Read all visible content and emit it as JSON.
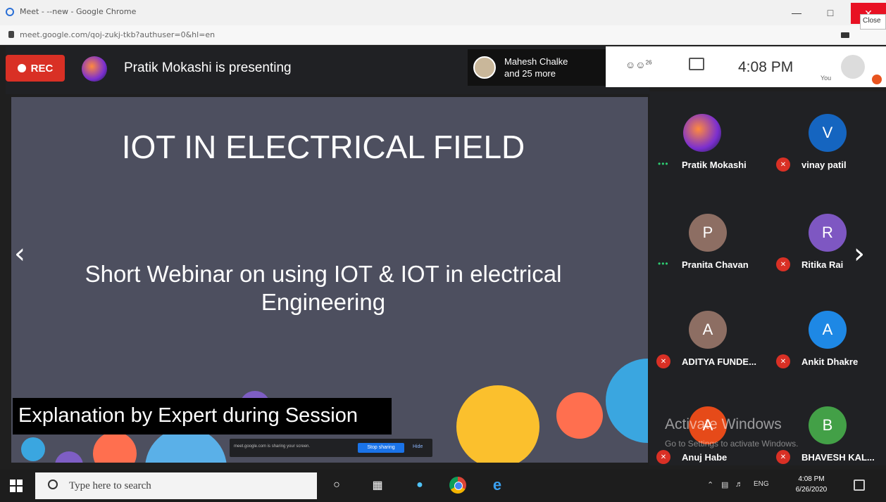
{
  "browser": {
    "window_title": "Meet - --new - Google Chrome",
    "url": "meet.google.com/qoj-zukj-tkb?authuser=0&hl=en",
    "close_tooltip": "Close"
  },
  "meet": {
    "rec_label": "REC",
    "presenting_text": "Pratik Mokashi is presenting",
    "attendees_line1": "Mahesh Chalke",
    "attendees_line2": "and 25 more",
    "people_count": "26",
    "time": "4:08 PM",
    "you_label": "You"
  },
  "slide": {
    "title": "IOT IN ELECTRICAL FIELD",
    "subtitle_line1": "Short Webinar on using IOT & IOT in electrical",
    "subtitle_line2": "Engineering",
    "caption": "Explanation by Expert during Session"
  },
  "share_bar": {
    "text": "meet.google.com is sharing your screen.",
    "stop_label": "Stop sharing",
    "hide_label": "Hide"
  },
  "participants": [
    {
      "name": "Pratik Mokashi",
      "initial": "",
      "color": "#3a2a66",
      "status": "speaking"
    },
    {
      "name": "vinay patil",
      "initial": "V",
      "color": "#1565c0",
      "status": "muted"
    },
    {
      "name": "Pranita Chavan",
      "initial": "P",
      "color": "#8d6e63",
      "status": "speaking"
    },
    {
      "name": "Ritika Rai",
      "initial": "R",
      "color": "#7e57c2",
      "status": "muted"
    },
    {
      "name": "ADITYA FUNDE...",
      "initial": "A",
      "color": "#8d6e63",
      "status": "muted"
    },
    {
      "name": "Ankit Dhakre",
      "initial": "A",
      "color": "#1e88e5",
      "status": "muted"
    },
    {
      "name": "Anuj Habe",
      "initial": "A",
      "color": "#e64a19",
      "status": "muted"
    },
    {
      "name": "BHAVESH KAL...",
      "initial": "B",
      "color": "#43a047",
      "status": "muted"
    }
  ],
  "watermark": {
    "line1": "Activate Windows",
    "line2": "Go to Settings to activate Windows."
  },
  "taskbar": {
    "search_placeholder": "Type here to search",
    "lang": "ENG",
    "time": "4:08 PM",
    "date": "6/26/2020"
  },
  "colors": {
    "rec_red": "#d93025",
    "slide_bg": "#4d4f5f",
    "meet_dark": "#202124"
  }
}
